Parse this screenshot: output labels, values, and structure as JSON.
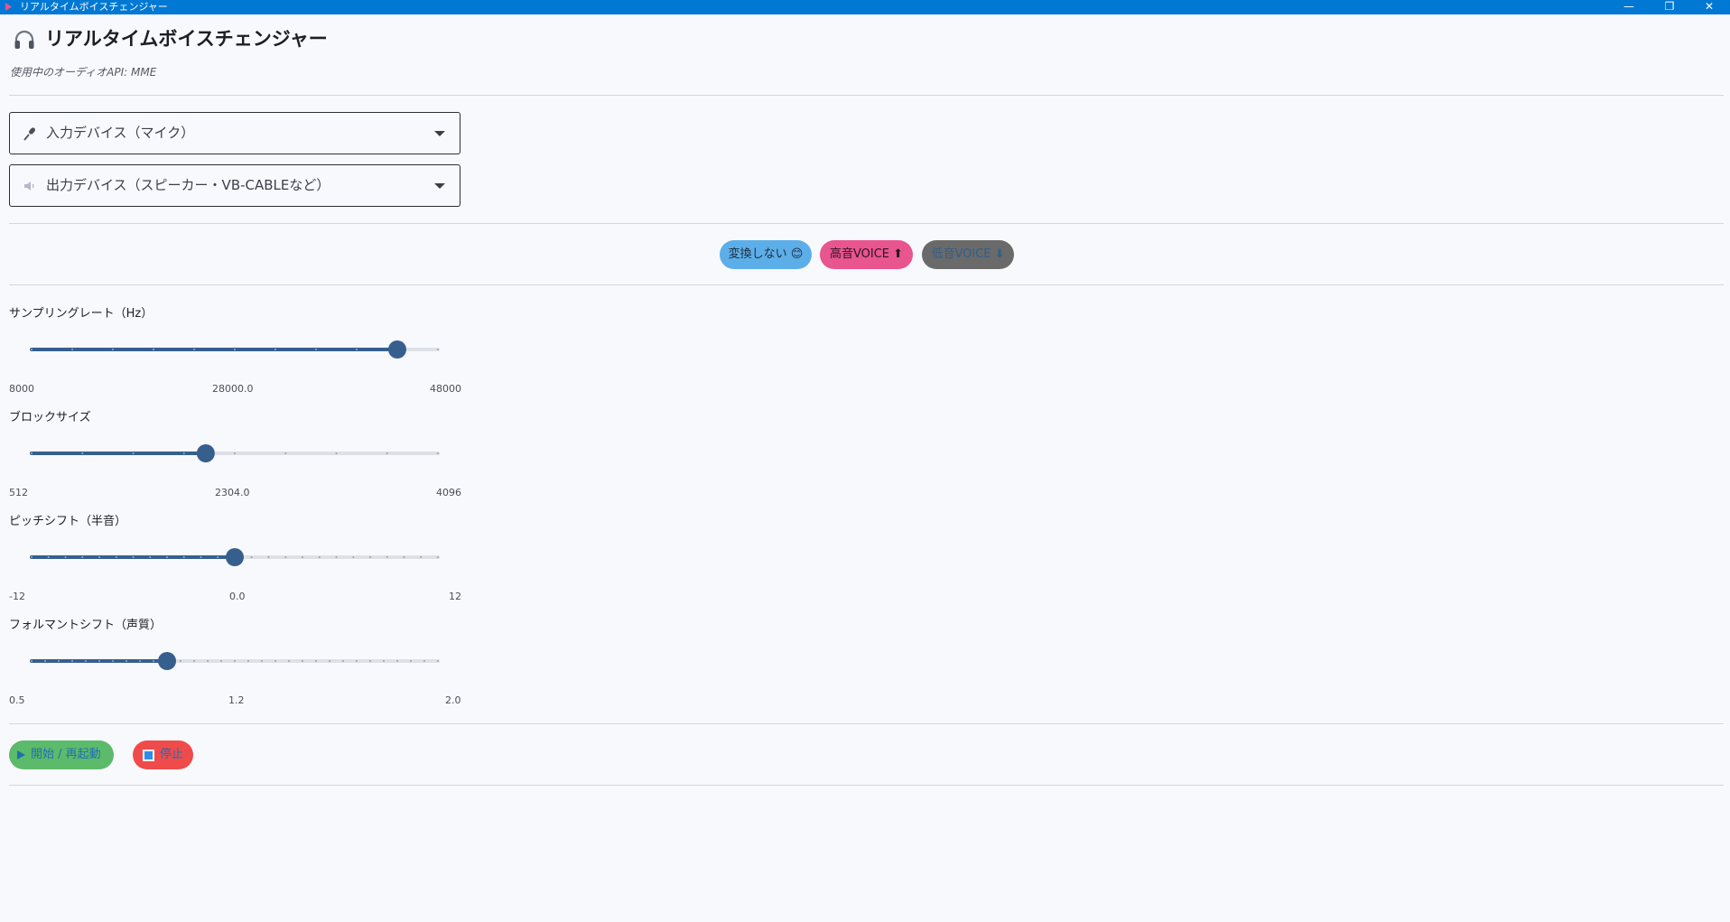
{
  "window": {
    "title": "リアルタイムボイスチェンジャー",
    "minimize_glyph": "—",
    "maximize_glyph": "❐",
    "close_glyph": "✕"
  },
  "header": {
    "title": "リアルタイムボイスチェンジャー",
    "icon": "headphones-icon",
    "api_note": "使用中のオーディオAPI: MME"
  },
  "devices": {
    "input_label": "入力デバイス（マイク）",
    "output_label": "出力デバイス（スピーカー・VB-CABLEなど）"
  },
  "presets": {
    "none_label": "変換しない 😊",
    "high_label": "高音VOICE ⬆",
    "low_label": "低音VOICE ⬇"
  },
  "sliders": [
    {
      "label": "サンプリングレート（Hz）",
      "min": 8000,
      "max": 48000,
      "value": 44000,
      "ticks": 10,
      "min_label": "8000",
      "mid_label": "28000.0",
      "max_label": "48000"
    },
    {
      "label": "ブロックサイズ",
      "min": 512,
      "max": 4096,
      "value": 2048,
      "ticks": 8,
      "min_label": "512",
      "mid_label": "2304.0",
      "max_label": "4096"
    },
    {
      "label": "ピッチシフト（半音）",
      "min": -12,
      "max": 12,
      "value": 0,
      "ticks": 24,
      "min_label": "-12",
      "mid_label": "0.0",
      "max_label": "12"
    },
    {
      "label": "フォルマントシフト（声質）",
      "min": 0.5,
      "max": 2.0,
      "value": 1.0,
      "ticks": 30,
      "min_label": "0.5",
      "mid_label": "1.2",
      "max_label": "2.0"
    }
  ],
  "actions": {
    "start_label": "開始 / 再起動",
    "stop_label": "停止"
  },
  "colors": {
    "accent": "#0078d4",
    "slider_active": "#365f8e",
    "slider_track": "#dde1e6"
  }
}
